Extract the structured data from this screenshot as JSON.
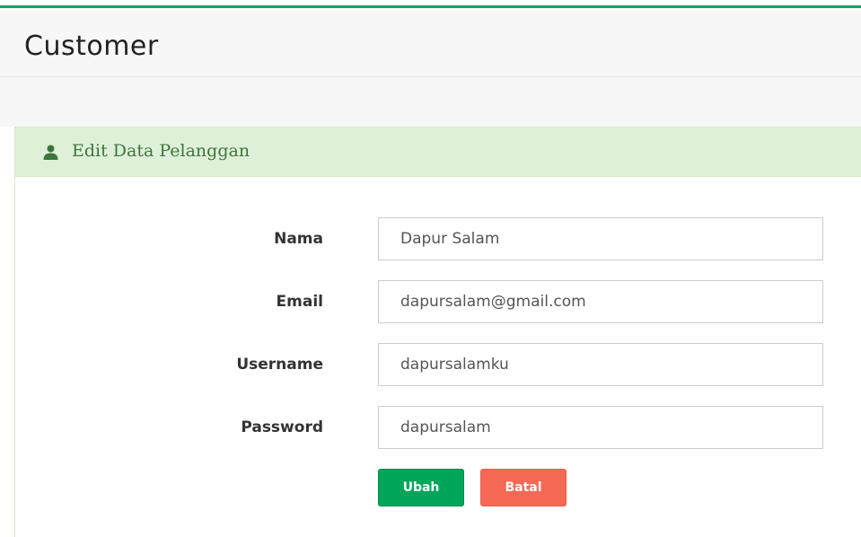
{
  "header": {
    "title": "Customer"
  },
  "panel": {
    "title": "Edit Data Pelanggan",
    "icon": "user-icon"
  },
  "form": {
    "fields": [
      {
        "label": "Nama",
        "value": "Dapur Salam"
      },
      {
        "label": "Email",
        "value": "dapursalam@gmail.com"
      },
      {
        "label": "Username",
        "value": "dapursalamku"
      },
      {
        "label": "Password",
        "value": "dapursalam"
      }
    ],
    "submit_label": "Ubah",
    "cancel_label": "Batal"
  },
  "colors": {
    "accent": "#1e9e5a",
    "panel_heading_bg": "#dff0d8",
    "panel_heading_text": "#3c763d",
    "submit_bg": "#00a65a",
    "cancel_bg": "#f56954"
  }
}
